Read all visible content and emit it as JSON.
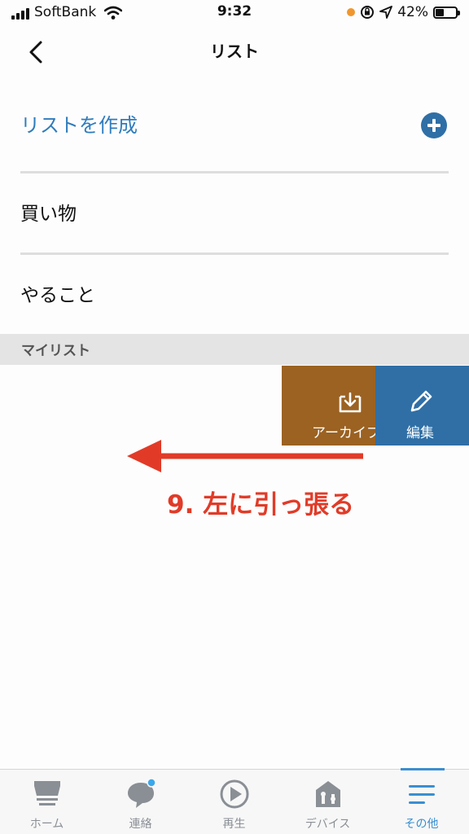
{
  "status_bar": {
    "carrier": "SoftBank",
    "time": "9:32",
    "battery_percent": "42%",
    "battery_level": 0.42,
    "icons": [
      "signal-icon",
      "wifi-icon",
      "orange-dot",
      "lock-rotation-icon",
      "location-icon",
      "battery-icon"
    ]
  },
  "nav": {
    "title": "リスト",
    "back_icon": "chevron-left-icon"
  },
  "create": {
    "label": "リストを作成",
    "icon": "plus-circle-icon"
  },
  "lists": [
    {
      "label": "買い物"
    },
    {
      "label": "やること"
    }
  ],
  "section": {
    "label": "マイリスト"
  },
  "swipe_actions": {
    "archive": {
      "label": "アーカイブ",
      "icon": "archive-download-icon",
      "color": "#9b6222"
    },
    "edit": {
      "label": "編集",
      "icon": "pencil-icon",
      "color": "#2f6fa6"
    }
  },
  "annotation": {
    "text": "9. 左に引っ張る",
    "color": "#e13b28",
    "arrow": "left-arrow"
  },
  "tabs": [
    {
      "label": "ホーム",
      "icon": "home-icon",
      "active": false
    },
    {
      "label": "連絡",
      "icon": "chat-bubble-icon",
      "active": false,
      "badge": true
    },
    {
      "label": "再生",
      "icon": "play-icon",
      "active": false
    },
    {
      "label": "デバイス",
      "icon": "devices-icon",
      "active": false
    },
    {
      "label": "その他",
      "icon": "menu-icon",
      "active": true
    }
  ],
  "colors": {
    "accent": "#2f7cbd",
    "tab_active": "#3a8fd0",
    "tab_inactive": "#8a8f95"
  }
}
